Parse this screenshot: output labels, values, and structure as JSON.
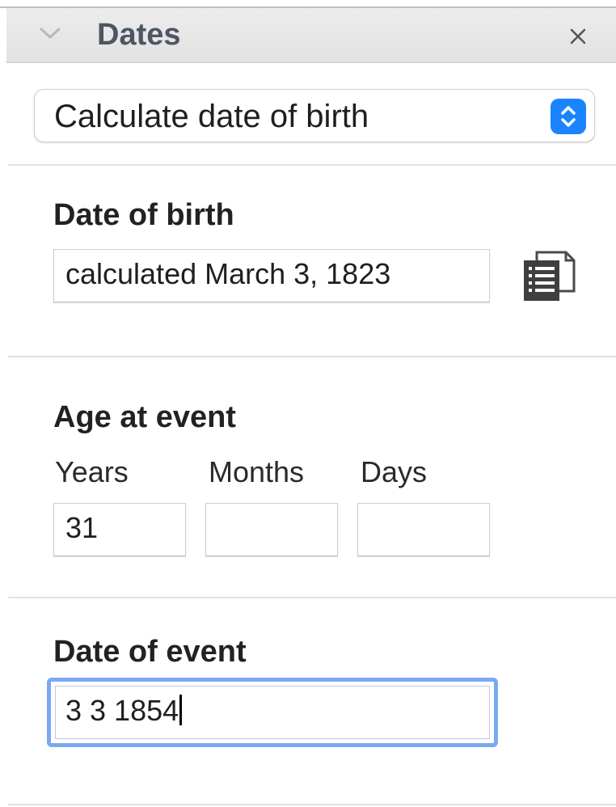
{
  "header": {
    "title": "Dates",
    "collapse_icon": "chevron-down-icon",
    "close_icon": "close-icon"
  },
  "mode_select": {
    "selected": "Calculate date of birth",
    "stepper_icon": "up-down-arrows-icon",
    "accent_color": "#1a84ff"
  },
  "date_of_birth": {
    "label": "Date of birth",
    "value": "calculated March 3, 1823",
    "copy_icon": "copy-document-icon"
  },
  "age_at_event": {
    "label": "Age at event",
    "years_label": "Years",
    "months_label": "Months",
    "days_label": "Days",
    "years_value": "31",
    "months_value": "",
    "days_value": ""
  },
  "date_of_event": {
    "label": "Date of event",
    "value": "3 3 1854",
    "focus_color": "#7aa9f3"
  }
}
